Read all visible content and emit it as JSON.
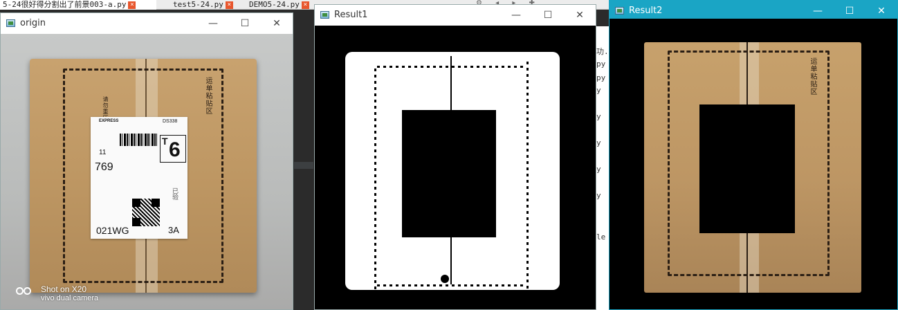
{
  "ide": {
    "tabs": [
      {
        "label": "5-24很好得分割出了前景003-a.py",
        "close": "×"
      },
      {
        "label": "test5-24.py",
        "close": "×"
      },
      {
        "label": "DEMO5-24.py",
        "close": "×"
      }
    ],
    "toolbar_glyphs": "⚙ ◂ ▸ ✚",
    "side_lines": [
      "功.p",
      "py",
      "py",
      "y",
      "y",
      "y",
      "y",
      "y"
    ],
    "side_bottom_text": "le"
  },
  "windows": {
    "origin": {
      "title": "origin",
      "minimize": "—",
      "maximize": "☐",
      "close": "✕",
      "photo": {
        "label_logo": "EXPRESS",
        "label_code_small": "DS338",
        "label_date": "11",
        "label_big_letter": "T",
        "label_big_num": "6",
        "label_number": "769",
        "label_code_bottom": "021WG",
        "label_zone": "3A",
        "label_side": "已验",
        "box_side_text": "运单粘贴区",
        "box_left_text": "请勿重压"
      },
      "watermark": {
        "line1": "Shot on X20",
        "line2": "vivo dual camera"
      }
    },
    "result1": {
      "title": "Result1",
      "minimize": "—",
      "maximize": "☐",
      "close": "✕"
    },
    "result2": {
      "title": "Result2",
      "minimize": "—",
      "maximize": "☐",
      "close": "✕",
      "box_side_text": "运单粘贴区"
    }
  },
  "colors": {
    "active_titlebar": "#1aa5c5",
    "cardboard": "#c29b67",
    "tab_close": "#e8562d"
  },
  "icons": [
    "app-icon",
    "minimize-icon",
    "maximize-icon",
    "close-icon",
    "settings-icon"
  ]
}
